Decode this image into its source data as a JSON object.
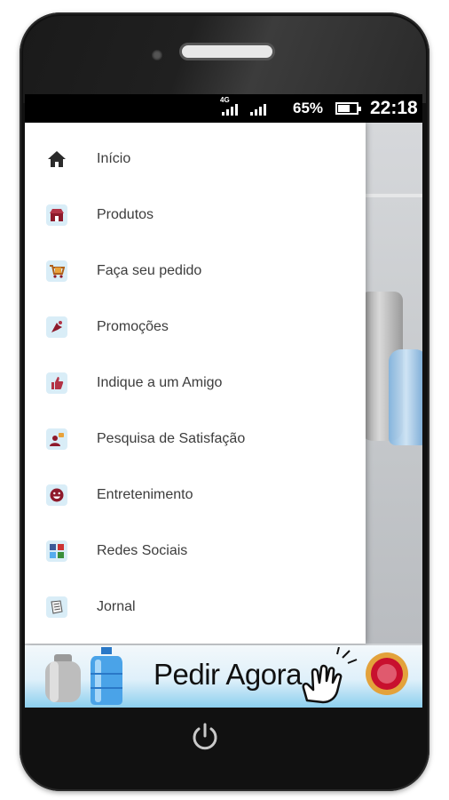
{
  "status_bar": {
    "network": "4G",
    "battery_percent": "65%",
    "battery_level": 0.65,
    "time": "22:18"
  },
  "menu": {
    "items": [
      {
        "label": "Início",
        "icon": "home-icon"
      },
      {
        "label": "Produtos",
        "icon": "store-icon"
      },
      {
        "label": "Faça seu pedido",
        "icon": "cart-icon"
      },
      {
        "label": "Promoções",
        "icon": "promo-icon"
      },
      {
        "label": "Indique a um Amigo",
        "icon": "thumbs-up-icon"
      },
      {
        "label": "Pesquisa de Satisfação",
        "icon": "survey-icon"
      },
      {
        "label": "Entretenimento",
        "icon": "smiley-icon"
      },
      {
        "label": "Redes Sociais",
        "icon": "social-icon"
      },
      {
        "label": "Jornal",
        "icon": "newspaper-icon"
      }
    ]
  },
  "banner": {
    "label": "Pedir Agora"
  },
  "colors": {
    "accent": "#8e1a2b",
    "tile": "#d9edf7",
    "text": "#3c3c3c"
  }
}
